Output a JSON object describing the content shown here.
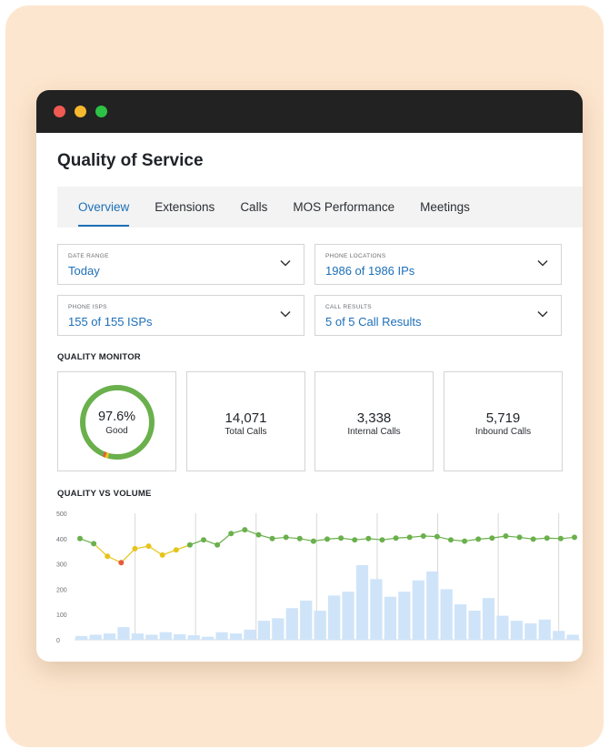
{
  "page": {
    "title": "Quality of Service"
  },
  "tabs": [
    {
      "label": "Overview",
      "active": true
    },
    {
      "label": "Extensions",
      "active": false
    },
    {
      "label": "Calls",
      "active": false
    },
    {
      "label": "MOS Performance",
      "active": false
    },
    {
      "label": "Meetings",
      "active": false
    }
  ],
  "filters": {
    "date_range": {
      "label": "DATE RANGE",
      "value": "Today"
    },
    "phone_locations": {
      "label": "PHONE LOCATIONS",
      "value": "1986 of 1986 IPs"
    },
    "phone_isps": {
      "label": "PHONE ISPS",
      "value": "155 of 155 ISPs"
    },
    "call_results": {
      "label": "CALL RESULTS",
      "value": "5 of 5 Call Results"
    }
  },
  "quality_monitor": {
    "heading": "QUALITY MONITOR",
    "score": {
      "value": "97.6%",
      "label": "Good",
      "fraction_good": 0.976
    },
    "cards": [
      {
        "value": "14,071",
        "label": "Total Calls"
      },
      {
        "value": "3,338",
        "label": "Internal Calls"
      },
      {
        "value": "5,719",
        "label": "Inbound Calls"
      }
    ]
  },
  "quality_vs_volume": {
    "heading": "QUALITY VS VOLUME"
  },
  "colors": {
    "accent": "#1d6fb8",
    "good": "#6ab04c",
    "warn": "#e6c419",
    "bad": "#e85a3c",
    "bar": "#cfe4f9"
  },
  "chart_data": {
    "type": "bar",
    "ylim": [
      0,
      500
    ],
    "yticks": [
      "0",
      "100",
      "200",
      "300",
      "400",
      "500"
    ],
    "bars": [
      15,
      20,
      25,
      50,
      25,
      20,
      30,
      22,
      18,
      12,
      30,
      25,
      40,
      75,
      85,
      125,
      155,
      115,
      175,
      190,
      295,
      240,
      170,
      190,
      235,
      270,
      200,
      140,
      115,
      165,
      95,
      75,
      65,
      80,
      35,
      20
    ],
    "line": [
      400,
      380,
      330,
      305,
      360,
      370,
      335,
      355,
      375,
      395,
      375,
      420,
      435,
      415,
      400,
      405,
      400,
      390,
      398,
      402,
      395,
      400,
      395,
      402,
      405,
      410,
      408,
      395,
      390,
      398,
      402,
      410,
      405,
      398,
      402,
      400,
      405
    ],
    "line_colors": [
      "good",
      "good",
      "warn",
      "bad",
      "warn",
      "warn",
      "warn",
      "warn",
      "good",
      "good",
      "good",
      "good",
      "good",
      "good",
      "good",
      "good",
      "good",
      "good",
      "good",
      "good",
      "good",
      "good",
      "good",
      "good",
      "good",
      "good",
      "good",
      "good",
      "good",
      "good",
      "good",
      "good",
      "good",
      "good",
      "good",
      "good",
      "good"
    ],
    "vertical_gridlines": 8
  }
}
